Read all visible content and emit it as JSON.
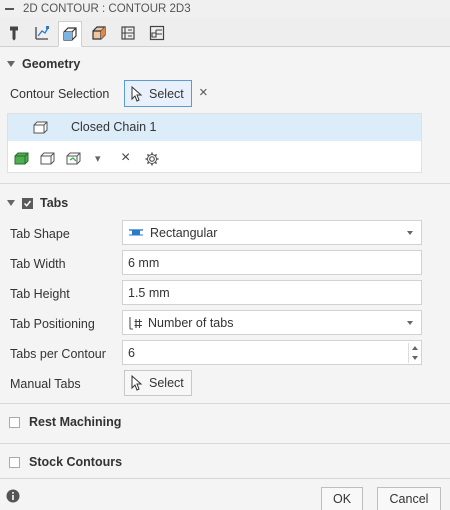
{
  "window": {
    "title": "2D CONTOUR : CONTOUR 2D3"
  },
  "toolbar": {
    "tabs": [
      "tool-icon",
      "geometry-icon",
      "passes-icon",
      "linking-icon",
      "heights-icon",
      "simulation-icon"
    ]
  },
  "geometry": {
    "heading": "Geometry",
    "contour_selection_label": "Contour Selection",
    "select_label": "Select",
    "clear_glyph": "×",
    "chain_item": "Closed Chain 1",
    "row_tools": {
      "delete_glyph": "×",
      "caret_glyph": "▾"
    }
  },
  "tabs": {
    "heading": "Tabs",
    "enabled": true,
    "tab_shape": {
      "label": "Tab Shape",
      "value": "Rectangular"
    },
    "tab_width": {
      "label": "Tab Width",
      "value": "6 mm"
    },
    "tab_height": {
      "label": "Tab Height",
      "value": "1.5 mm"
    },
    "tab_positioning": {
      "label": "Tab Positioning",
      "value": "Number of tabs"
    },
    "tabs_per_contour": {
      "label": "Tabs per Contour",
      "value": "6"
    },
    "manual_tabs": {
      "label": "Manual Tabs",
      "select_label": "Select"
    }
  },
  "rest_machining": {
    "label": "Rest Machining",
    "checked": false
  },
  "stock_contours": {
    "label": "Stock Contours",
    "checked": false
  },
  "footer": {
    "ok_label": "OK",
    "cancel_label": "Cancel"
  },
  "colors": {
    "select_active_border": "#5a9bd5",
    "chain_row_bg": "#dcecf9",
    "green_face": "#4caf50"
  }
}
